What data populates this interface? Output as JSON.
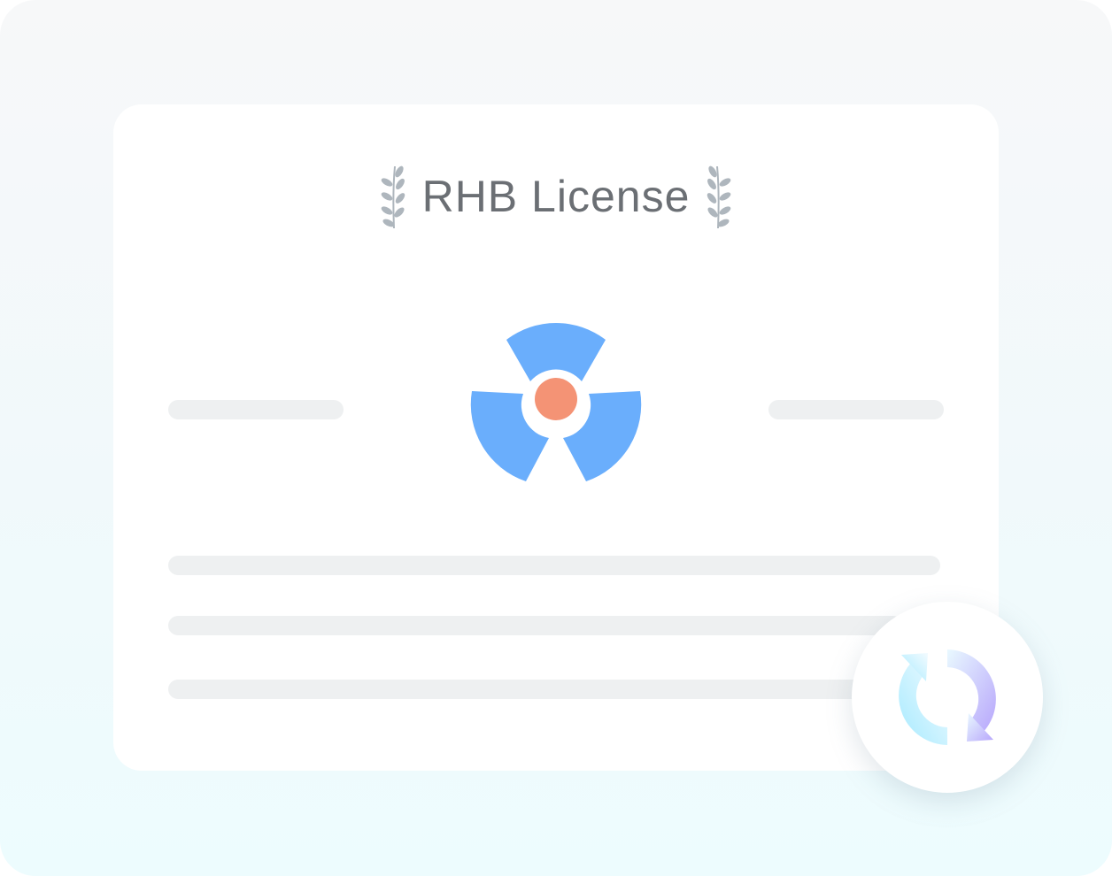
{
  "license": {
    "title": "RHB License",
    "laurel_icon": "laurel-branch-icon",
    "emblem_icon": "radiation-hazard-icon",
    "action_icon": "refresh-icon"
  },
  "colors": {
    "title_text": "#6b6f74",
    "laurel": "#aeb6bd",
    "hazard_blades": "#6aaefc",
    "hazard_core": "#f49375",
    "placeholder_bar": "#eef0f1",
    "refresh_start": "#a6eaff",
    "refresh_end": "#b7a6fb"
  }
}
